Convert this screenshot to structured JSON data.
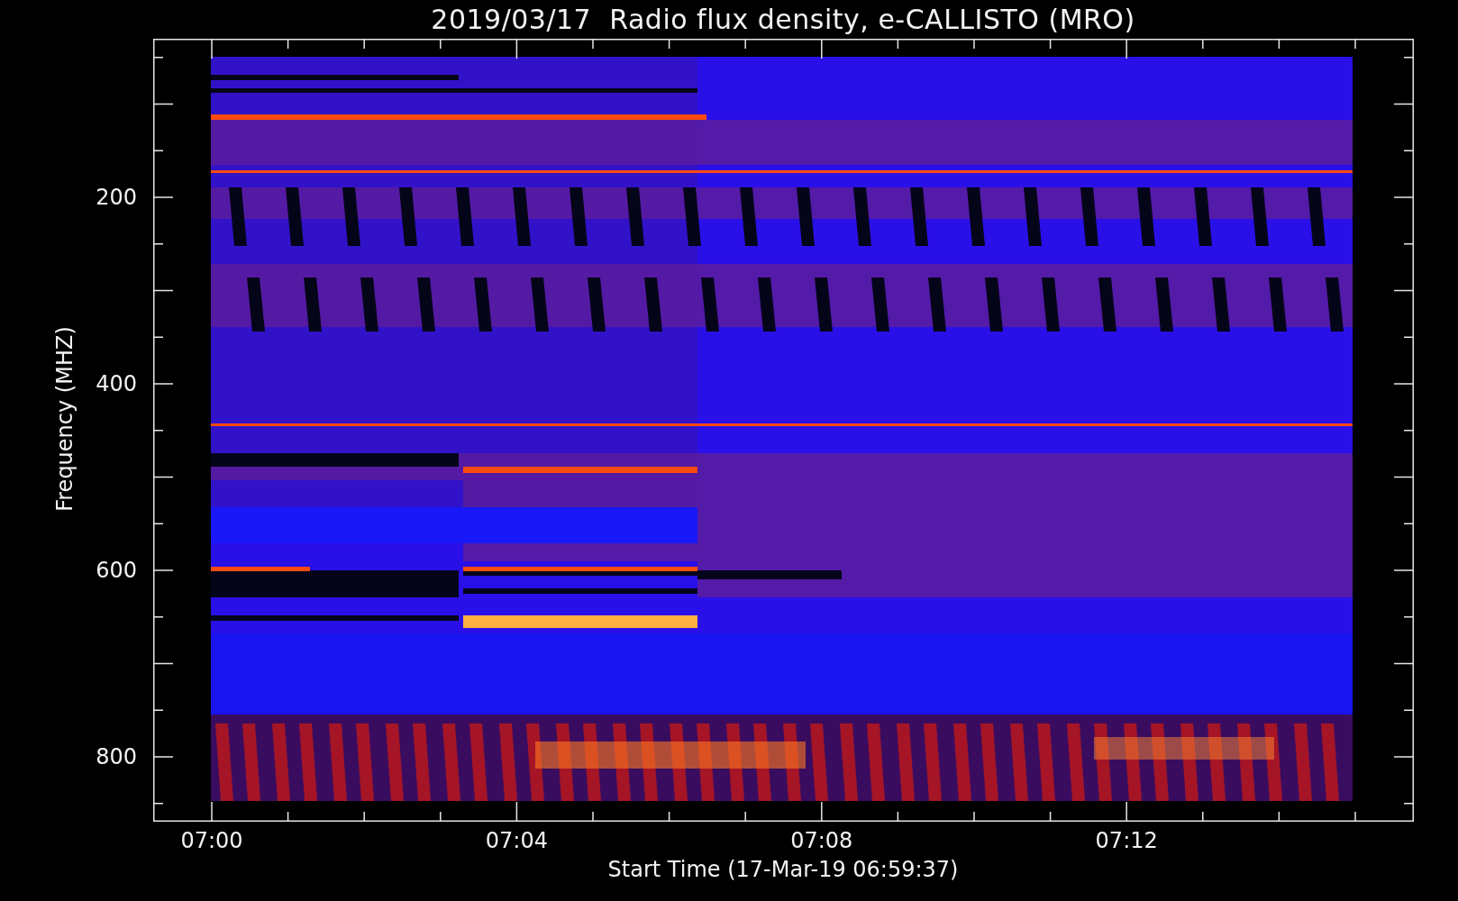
{
  "title": "2019/03/17  Radio flux density, e-CALLISTO (MRO)",
  "y_axis": {
    "label": "Frequency (MHZ)",
    "ticks": [
      "200",
      "400",
      "600",
      "800"
    ]
  },
  "x_axis": {
    "label": "Start Time (17-Mar-19 06:59:37)",
    "ticks": [
      "07:00",
      "07:04",
      "07:08",
      "07:12"
    ]
  }
}
